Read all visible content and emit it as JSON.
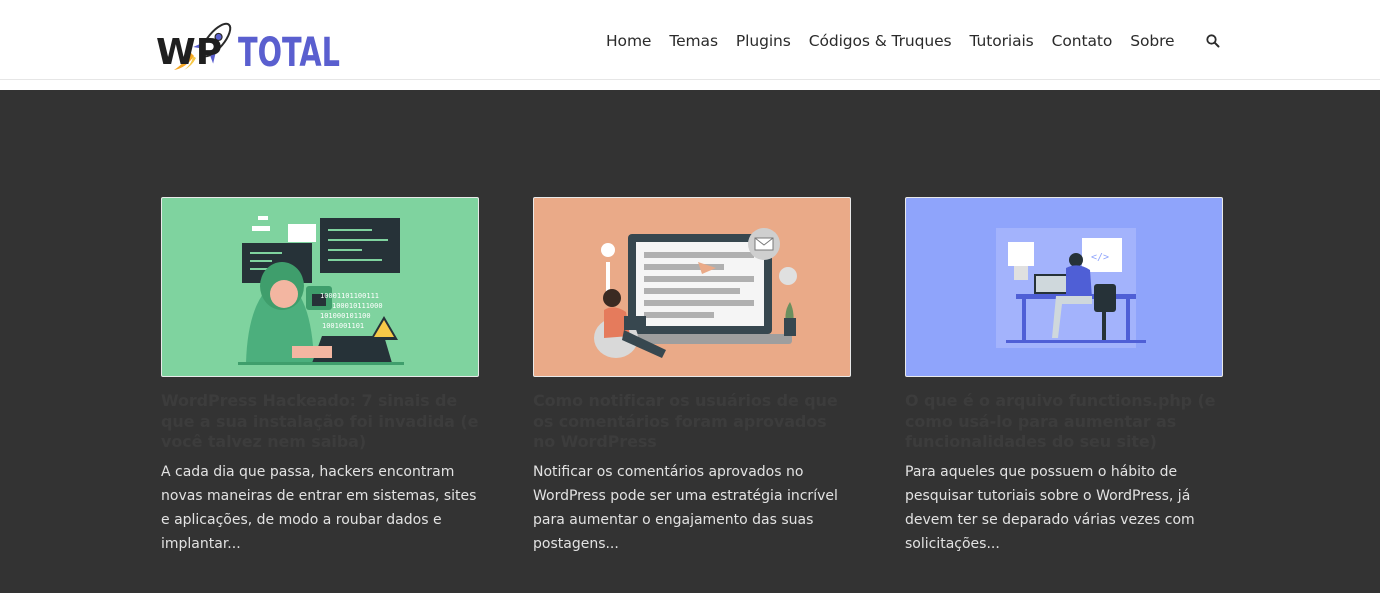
{
  "site": {
    "logo_wp": "WP",
    "logo_total": "TOTAL",
    "colors": {
      "header_bg": "#ffffff",
      "page_bg": "#333333",
      "brand": "#5a5fcf",
      "title_text": "#3c3c3c",
      "excerpt_text": "#e2e2e2"
    }
  },
  "nav": {
    "items": [
      {
        "label": "Home"
      },
      {
        "label": "Temas"
      },
      {
        "label": "Plugins"
      },
      {
        "label": "Códigos & Truques"
      },
      {
        "label": "Tutoriais"
      },
      {
        "label": "Contato"
      },
      {
        "label": "Sobre"
      }
    ],
    "search_icon": "search-icon"
  },
  "posts": [
    {
      "image_bg": "#7fd39f",
      "title": "WordPress Hackeado: 7 sinais de que a sua instalação foi invadida (e você talvez nem saiba)",
      "excerpt": "A cada dia que passa, hackers encontram novas maneiras de entrar em sistemas, sites e aplicações, de modo a roubar dados e implantar..."
    },
    {
      "image_bg": "#eaaa88",
      "title": "Como notificar os usuários de que os comentários foram aprovados no WordPress",
      "excerpt": "Notificar os comentários aprovados no WordPress pode ser uma estratégia incrível para aumentar o engajamento das suas postagens..."
    },
    {
      "image_bg": "#8fa4fb",
      "title": "O que é o arquivo functions.php (e como usá-lo para aumentar as funcionalidades do seu site)",
      "excerpt": "Para aqueles que possuem o hábito de pesquisar tutoriais sobre o WordPress, já devem ter se deparado várias vezes com solicitações..."
    }
  ]
}
